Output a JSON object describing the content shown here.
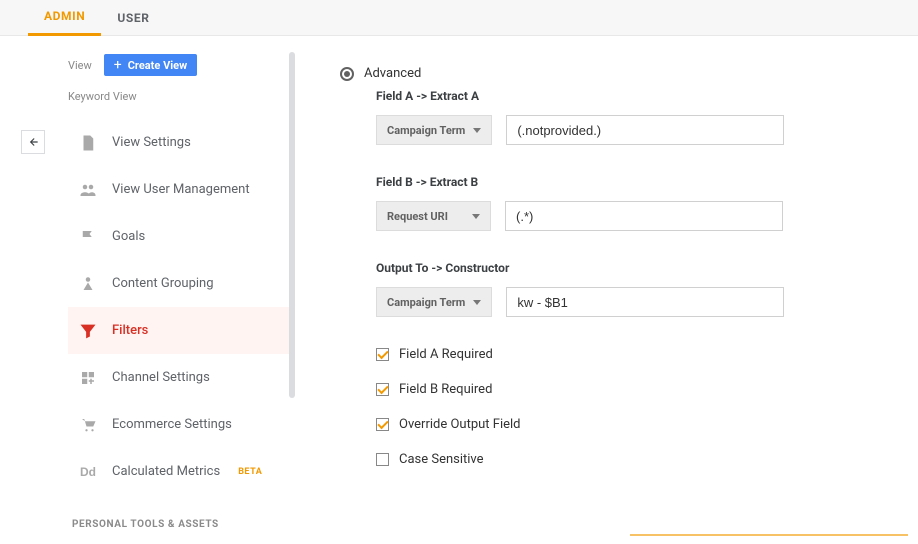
{
  "tabs": {
    "admin": "ADMIN",
    "user": "USER"
  },
  "sidebar": {
    "view_label": "View",
    "create_view": "Create View",
    "keyword_view": "Keyword View",
    "items": [
      {
        "label": "View Settings"
      },
      {
        "label": "View User Management"
      },
      {
        "label": "Goals"
      },
      {
        "label": "Content Grouping"
      },
      {
        "label": "Filters"
      },
      {
        "label": "Channel Settings"
      },
      {
        "label": "Ecommerce Settings"
      },
      {
        "label": "Calculated Metrics",
        "beta": "BETA"
      }
    ],
    "section": "PERSONAL TOOLS & ASSETS"
  },
  "form": {
    "radio_label": "Advanced",
    "fieldA": {
      "label": "Field A -> Extract A",
      "dropdown": "Campaign Term",
      "value": "(.notprovided.)"
    },
    "fieldB": {
      "label": "Field B -> Extract B",
      "dropdown": "Request URI",
      "value": "(.*)"
    },
    "output": {
      "label": "Output To -> Constructor",
      "dropdown": "Campaign Term",
      "value": "kw - $B1"
    },
    "checks": {
      "fieldA_required": "Field A Required",
      "fieldB_required": "Field B Required",
      "override": "Override Output Field",
      "case_sensitive": "Case Sensitive"
    }
  }
}
